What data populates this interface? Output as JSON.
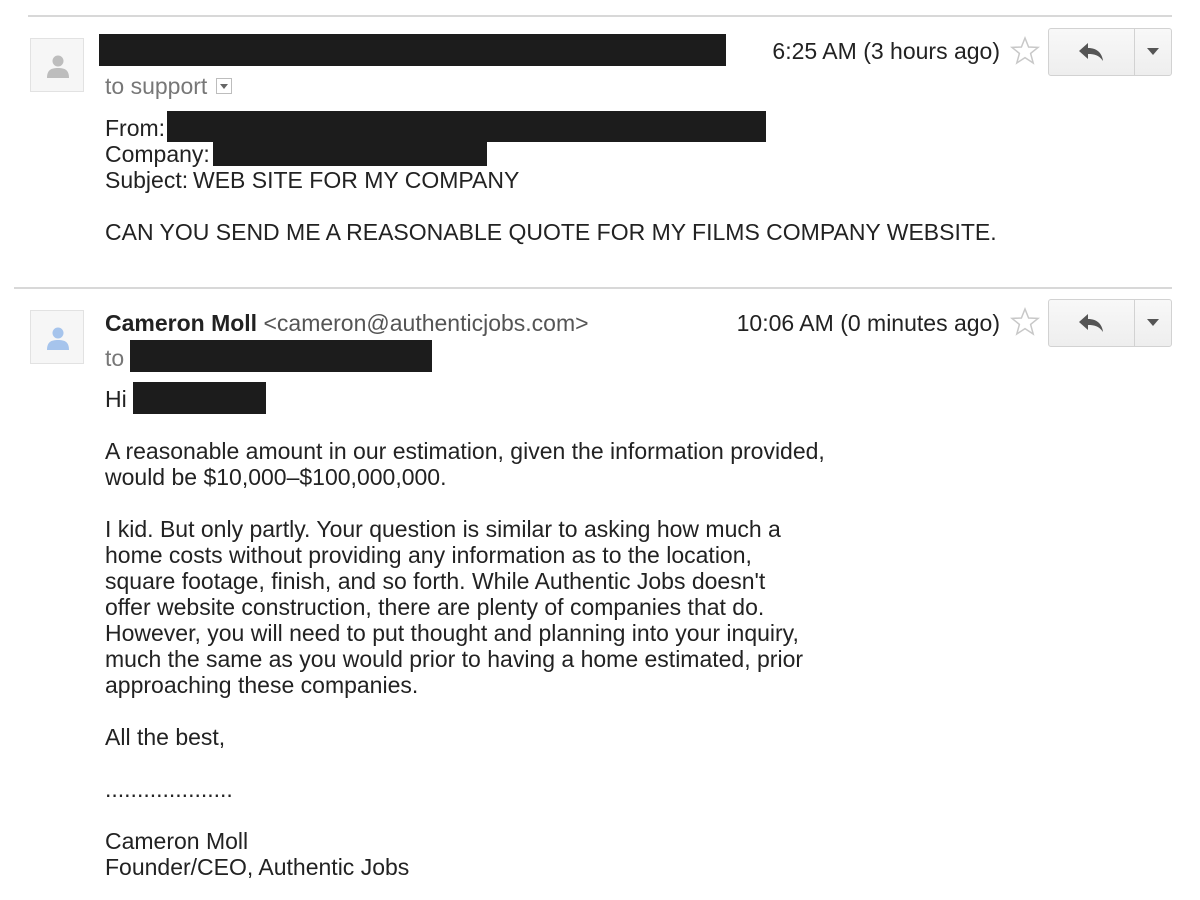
{
  "message1": {
    "time": "6:25 AM (3 hours ago)",
    "to_label": "to support",
    "from_label": "From:",
    "company_label": "Company:",
    "subject_label": "Subject:",
    "subject": "WEB SITE FOR MY COMPANY",
    "body": "CAN YOU SEND ME A REASONABLE QUOTE FOR MY FILMS COMPANY WEBSITE."
  },
  "message2": {
    "sender_name": "Cameron Moll",
    "sender_email": "<cameron@authenticjobs.com>",
    "time": "10:06 AM (0 minutes ago)",
    "to_label": "to",
    "greeting": "Hi",
    "para1": [
      "A reasonable amount in our estimation, given the information provided,",
      "would be $10,000–$100,000,000."
    ],
    "para2": [
      "I kid. But only partly. Your question is similar to asking how much a",
      "home costs without providing any information as to the location,",
      "square footage, finish, and so forth. While Authentic Jobs doesn't",
      "offer website construction, there are plenty of companies that do.",
      "However, you will need to put thought and planning into your inquiry,",
      "much the same as you would prior to having a home estimated, prior",
      "approaching these companies."
    ],
    "closing": "All the best,",
    "separator": "....................",
    "signature_name": "Cameron Moll",
    "signature_title": "Founder/CEO, Authentic Jobs"
  },
  "icons": {
    "avatar": "person-silhouette-icon",
    "star": "star-outline-icon",
    "reply": "reply-arrow-icon",
    "more": "chevron-down-icon",
    "to_details": "caret-down-icon"
  },
  "colors": {
    "avatar_grey": "#bdbdbd",
    "avatar_blue": "#a6c4ec",
    "redaction": "#1c1c1c",
    "divider": "#d8d8d8"
  }
}
